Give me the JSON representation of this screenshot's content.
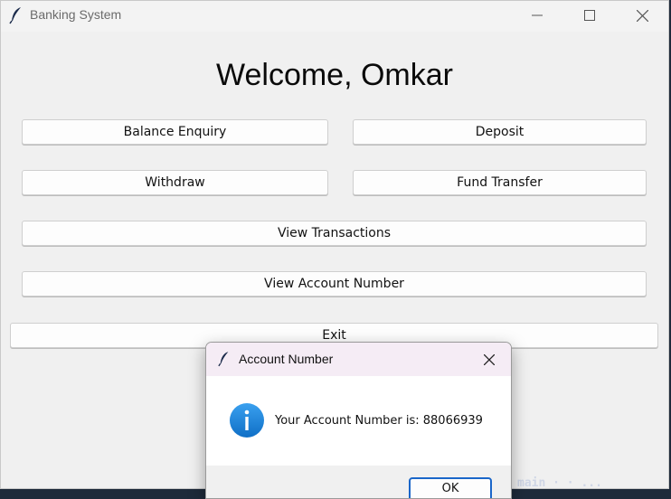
{
  "window": {
    "title": "Banking System",
    "icon": "feather-icon",
    "controls": [
      "minimize-icon",
      "maximize-icon",
      "close-icon"
    ]
  },
  "main": {
    "welcome": "Welcome, Omkar",
    "buttons": {
      "balance_enquiry": "Balance Enquiry",
      "deposit": "Deposit",
      "withdraw": "Withdraw",
      "fund_transfer": "Fund Transfer",
      "view_transactions": "View Transactions",
      "view_account_number": "View Account Number",
      "exit": "Exit"
    }
  },
  "dialog": {
    "title": "Account Number",
    "icon": "info-icon",
    "message": "Your Account Number is: 88066939",
    "ok_label": "OK"
  },
  "background": {
    "partial_text": "main · · ..."
  },
  "colors": {
    "accent": "#1a66c9",
    "info": "#1e88e5",
    "dialog_titlebar": "#f5ecf5"
  }
}
